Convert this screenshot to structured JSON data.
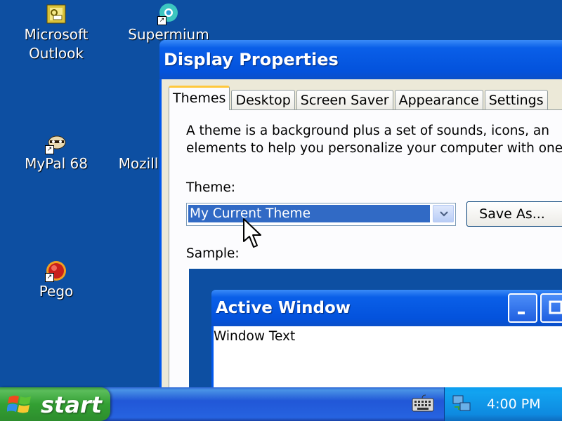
{
  "desktop": {
    "icons": [
      {
        "label_line1": "Microsoft",
        "label_line2": "Outlook",
        "icon": "outlook-icon"
      },
      {
        "label_line1": "Supermium",
        "icon": "supermium-icon"
      },
      {
        "label_line1": "MyPal 68",
        "icon": "mypal-icon"
      },
      {
        "label_line1": "Mozill",
        "icon": "mozilla-icon"
      },
      {
        "label_line1": "Pego",
        "icon": "pego-icon"
      }
    ]
  },
  "window": {
    "title": "Display Properties",
    "tabs": [
      "Themes",
      "Desktop",
      "Screen Saver",
      "Appearance",
      "Settings"
    ],
    "active_tab": "Themes",
    "description_line1": "A theme is a background plus a set of sounds, icons, an",
    "description_line2": "elements to help you personalize your computer with one",
    "theme_label": "Theme:",
    "theme_value": "My Current Theme",
    "save_as_label": "Save As...",
    "sample_label": "Sample:",
    "sample": {
      "window_title": "Active Window",
      "window_text": "Window Text"
    }
  },
  "taskbar": {
    "start_label": "start",
    "clock": "4:00 PM",
    "tray_icons": [
      "keyboard-icon",
      "network-icon"
    ]
  },
  "colors": {
    "desktop": "#0d4fa2",
    "titlebar": "#0352dc",
    "selection": "#316ac5",
    "start_button": "#33a033",
    "tray": "#0e8ae0"
  }
}
